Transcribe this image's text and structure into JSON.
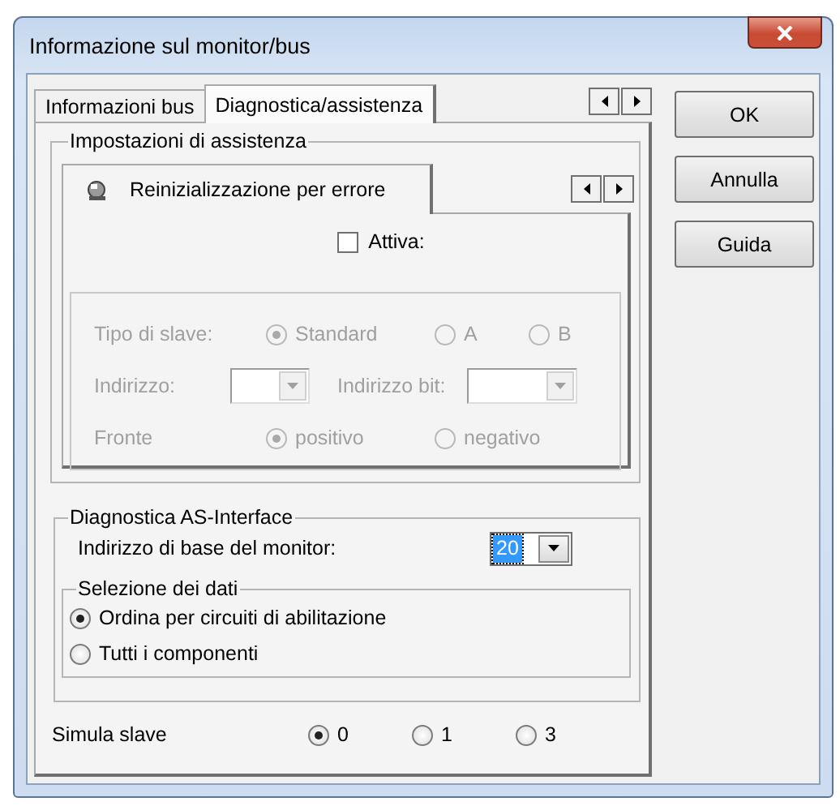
{
  "window": {
    "title": "Informazione sul monitor/bus"
  },
  "tabs": [
    {
      "label": "Informazioni bus",
      "selected": false
    },
    {
      "label": "Diagnostica/assistenza",
      "selected": true
    }
  ],
  "assistance": {
    "title": "Impostazioni di assistenza",
    "tabs": [
      {
        "label": "Reinizializzazione per errore",
        "selected": true
      }
    ],
    "active": {
      "label": "Attiva:",
      "checked": false
    },
    "settings": {
      "disabled": true,
      "slave_type": {
        "label": "Tipo di slave:",
        "options": [
          {
            "label": "Standard",
            "selected": true
          },
          {
            "label": "A",
            "selected": false
          },
          {
            "label": "B",
            "selected": false
          }
        ]
      },
      "address": {
        "label": "Indirizzo:"
      },
      "bit_address": {
        "label": "Indirizzo bit:"
      },
      "edge": {
        "label": "Fronte",
        "options": [
          {
            "label": "positivo",
            "selected": true
          },
          {
            "label": "negativo",
            "selected": false
          }
        ]
      }
    }
  },
  "diagnostics": {
    "title": "Diagnostica AS-Interface",
    "base_address": {
      "label": "Indirizzo di base del monitor:",
      "value": "20"
    },
    "data_selection": {
      "title": "Selezione dei dati",
      "options": [
        {
          "label": "Ordina per circuiti di abilitazione",
          "selected": true
        },
        {
          "label": "Tutti i componenti",
          "selected": false
        }
      ]
    }
  },
  "simulate": {
    "label": "Simula slave",
    "options": [
      {
        "label": "0",
        "selected": true
      },
      {
        "label": "1",
        "selected": false
      },
      {
        "label": "3",
        "selected": false
      }
    ]
  },
  "buttons": [
    {
      "label": "OK"
    },
    {
      "label": "Annulla"
    },
    {
      "label": "Guida"
    }
  ]
}
